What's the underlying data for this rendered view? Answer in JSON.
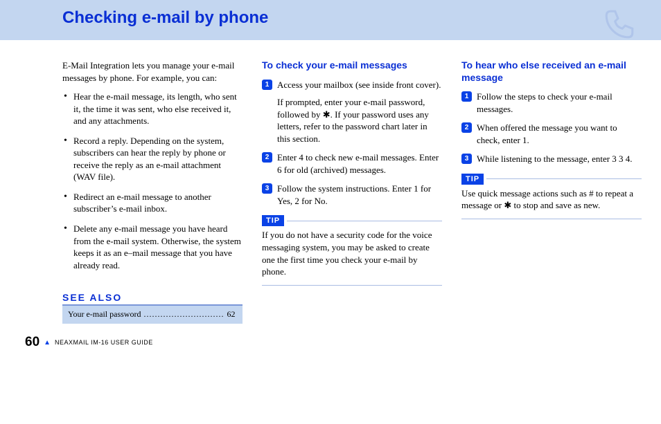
{
  "header": {
    "title": "Checking e-mail by phone"
  },
  "intro": "E-Mail Integration lets you manage your e-mail messages by phone. For example, you can:",
  "bullets": [
    "Hear the e-mail message, its length, who sent it, the time it was sent, who else received it, and any attachments.",
    "Record a reply. Depending on the system, subscribers can hear the reply by phone or receive the reply as an e-mail attachment (WAV file).",
    "Redirect an e-mail message to another subscriber’s e-mail inbox.",
    "Delete any e-mail message you have heard from the e-mail system. Otherwise, the system keeps it as an e–mail message that you have already read."
  ],
  "see_also": {
    "heading": "SEE ALSO",
    "item_label": "Your e-mail password",
    "item_page": "62"
  },
  "col2": {
    "heading": "To check your e-mail messages",
    "steps": [
      {
        "paras": [
          "Access your mailbox (see inside front cover).",
          "If prompted, enter your e-mail password, followed by ✱. If your password uses any letters, refer to the password chart later in this section."
        ]
      },
      {
        "paras": [
          "Enter 4 to check new e-mail messages. Enter 6 for old (archived) messages."
        ]
      },
      {
        "paras": [
          "Follow the system instructions. Enter 1 for Yes, 2 for No."
        ]
      }
    ],
    "tip_label": "TIP",
    "tip_body": "If you do not have a security code for the voice messaging system, you may be asked to create one the first time you check your e-mail by phone."
  },
  "col3": {
    "heading": "To hear who else received an e-mail message",
    "steps": [
      {
        "paras": [
          "Follow the steps to check your e-mail messages."
        ]
      },
      {
        "paras": [
          "When offered the message you want to check, enter 1."
        ]
      },
      {
        "paras": [
          "While listening to the message, enter 3 3 4."
        ]
      }
    ],
    "tip_label": "TIP",
    "tip_body": "Use quick message actions such as # to repeat a message or ✱ to stop and save as new."
  },
  "footer": {
    "page_number": "60",
    "guide": "NEAXMAIL IM-16 USER GUIDE"
  }
}
